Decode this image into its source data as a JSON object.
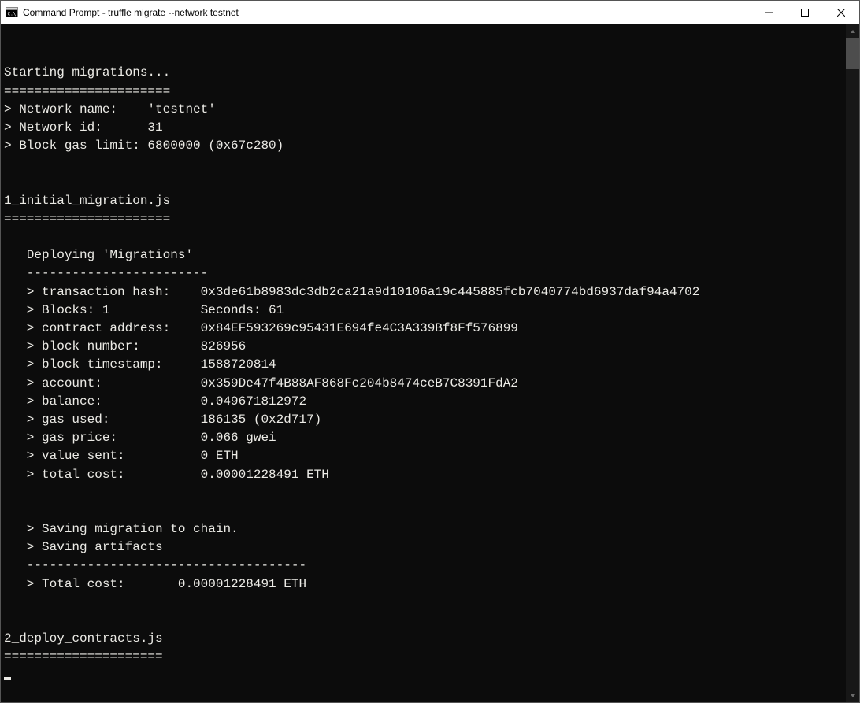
{
  "window": {
    "title": "Command Prompt - truffle  migrate --network testnet"
  },
  "terminal": {
    "blank_top": "",
    "starting": "Starting migrations...",
    "starting_rule": "======================",
    "net_name": "> Network name:    'testnet'",
    "net_id": "> Network id:      31",
    "gas_limit": "> Block gas limit: 6800000 (0x67c280)",
    "blank_a": "",
    "blank_b": "",
    "mig1_title": "1_initial_migration.js",
    "mig1_rule": "======================",
    "blank_c": "",
    "deploy_head": "   Deploying 'Migrations'",
    "deploy_dash": "   ------------------------",
    "txhash": "   > transaction hash:    0x3de61b8983dc3db2ca21a9d10106a19c445885fcb7040774bd6937daf94a4702",
    "blocks": "   > Blocks: 1            Seconds: 61",
    "contract": "   > contract address:    0x84EF593269c95431E694fe4C3A339Bf8Ff576899",
    "blocknum": "   > block number:        826956",
    "blockts": "   > block timestamp:     1588720814",
    "account": "   > account:             0x359De47f4B88AF868Fc204b8474ceB7C8391FdA2",
    "balance": "   > balance:             0.049671812972",
    "gasused": "   > gas used:            186135 (0x2d717)",
    "gasprice": "   > gas price:           0.066 gwei",
    "valuesent": "   > value sent:          0 ETH",
    "totalcost": "   > total cost:          0.00001228491 ETH",
    "blank_d": "",
    "blank_e": "",
    "save_chain": "   > Saving migration to chain.",
    "save_art": "   > Saving artifacts",
    "dash_long": "   -------------------------------------",
    "total_line": "   > Total cost:       0.00001228491 ETH",
    "blank_f": "",
    "blank_g": "",
    "mig2_title": "2_deploy_contracts.js",
    "mig2_rule": "====================="
  }
}
